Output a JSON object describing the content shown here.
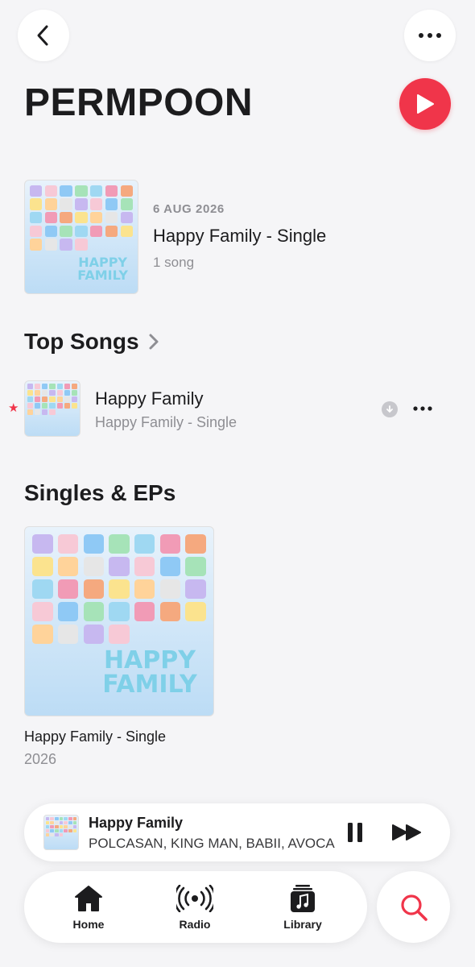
{
  "header": {
    "artist_name": "PERMPOON"
  },
  "latest_release": {
    "date": "6 AUG 2026",
    "title": "Happy Family - Single",
    "song_count": "1 song",
    "artwork_text": "HAPPY FAMILY"
  },
  "top_songs": {
    "title": "Top Songs",
    "items": [
      {
        "title": "Happy Family",
        "subtitle": "Happy Family - Single",
        "marker": "★"
      }
    ]
  },
  "singles": {
    "title": "Singles & EPs",
    "items": [
      {
        "title": "Happy Family - Single",
        "year": "2026"
      }
    ]
  },
  "mini_player": {
    "title": "Happy Family",
    "artists": "POLCASAN, KING MAN, BABII, AVOCADO"
  },
  "tabbar": {
    "home": "Home",
    "radio": "Radio",
    "library": "Library"
  },
  "colors": {
    "accent": "#f0354a",
    "secondary_text": "#8e8e93",
    "background": "#f5f5f7"
  },
  "icons": [
    "chevron-left-icon",
    "ellipsis-icon",
    "play-icon",
    "chevron-right-icon",
    "download-icon",
    "pause-icon",
    "forward-icon",
    "house-icon",
    "radio-waves-icon",
    "library-icon",
    "search-icon"
  ]
}
